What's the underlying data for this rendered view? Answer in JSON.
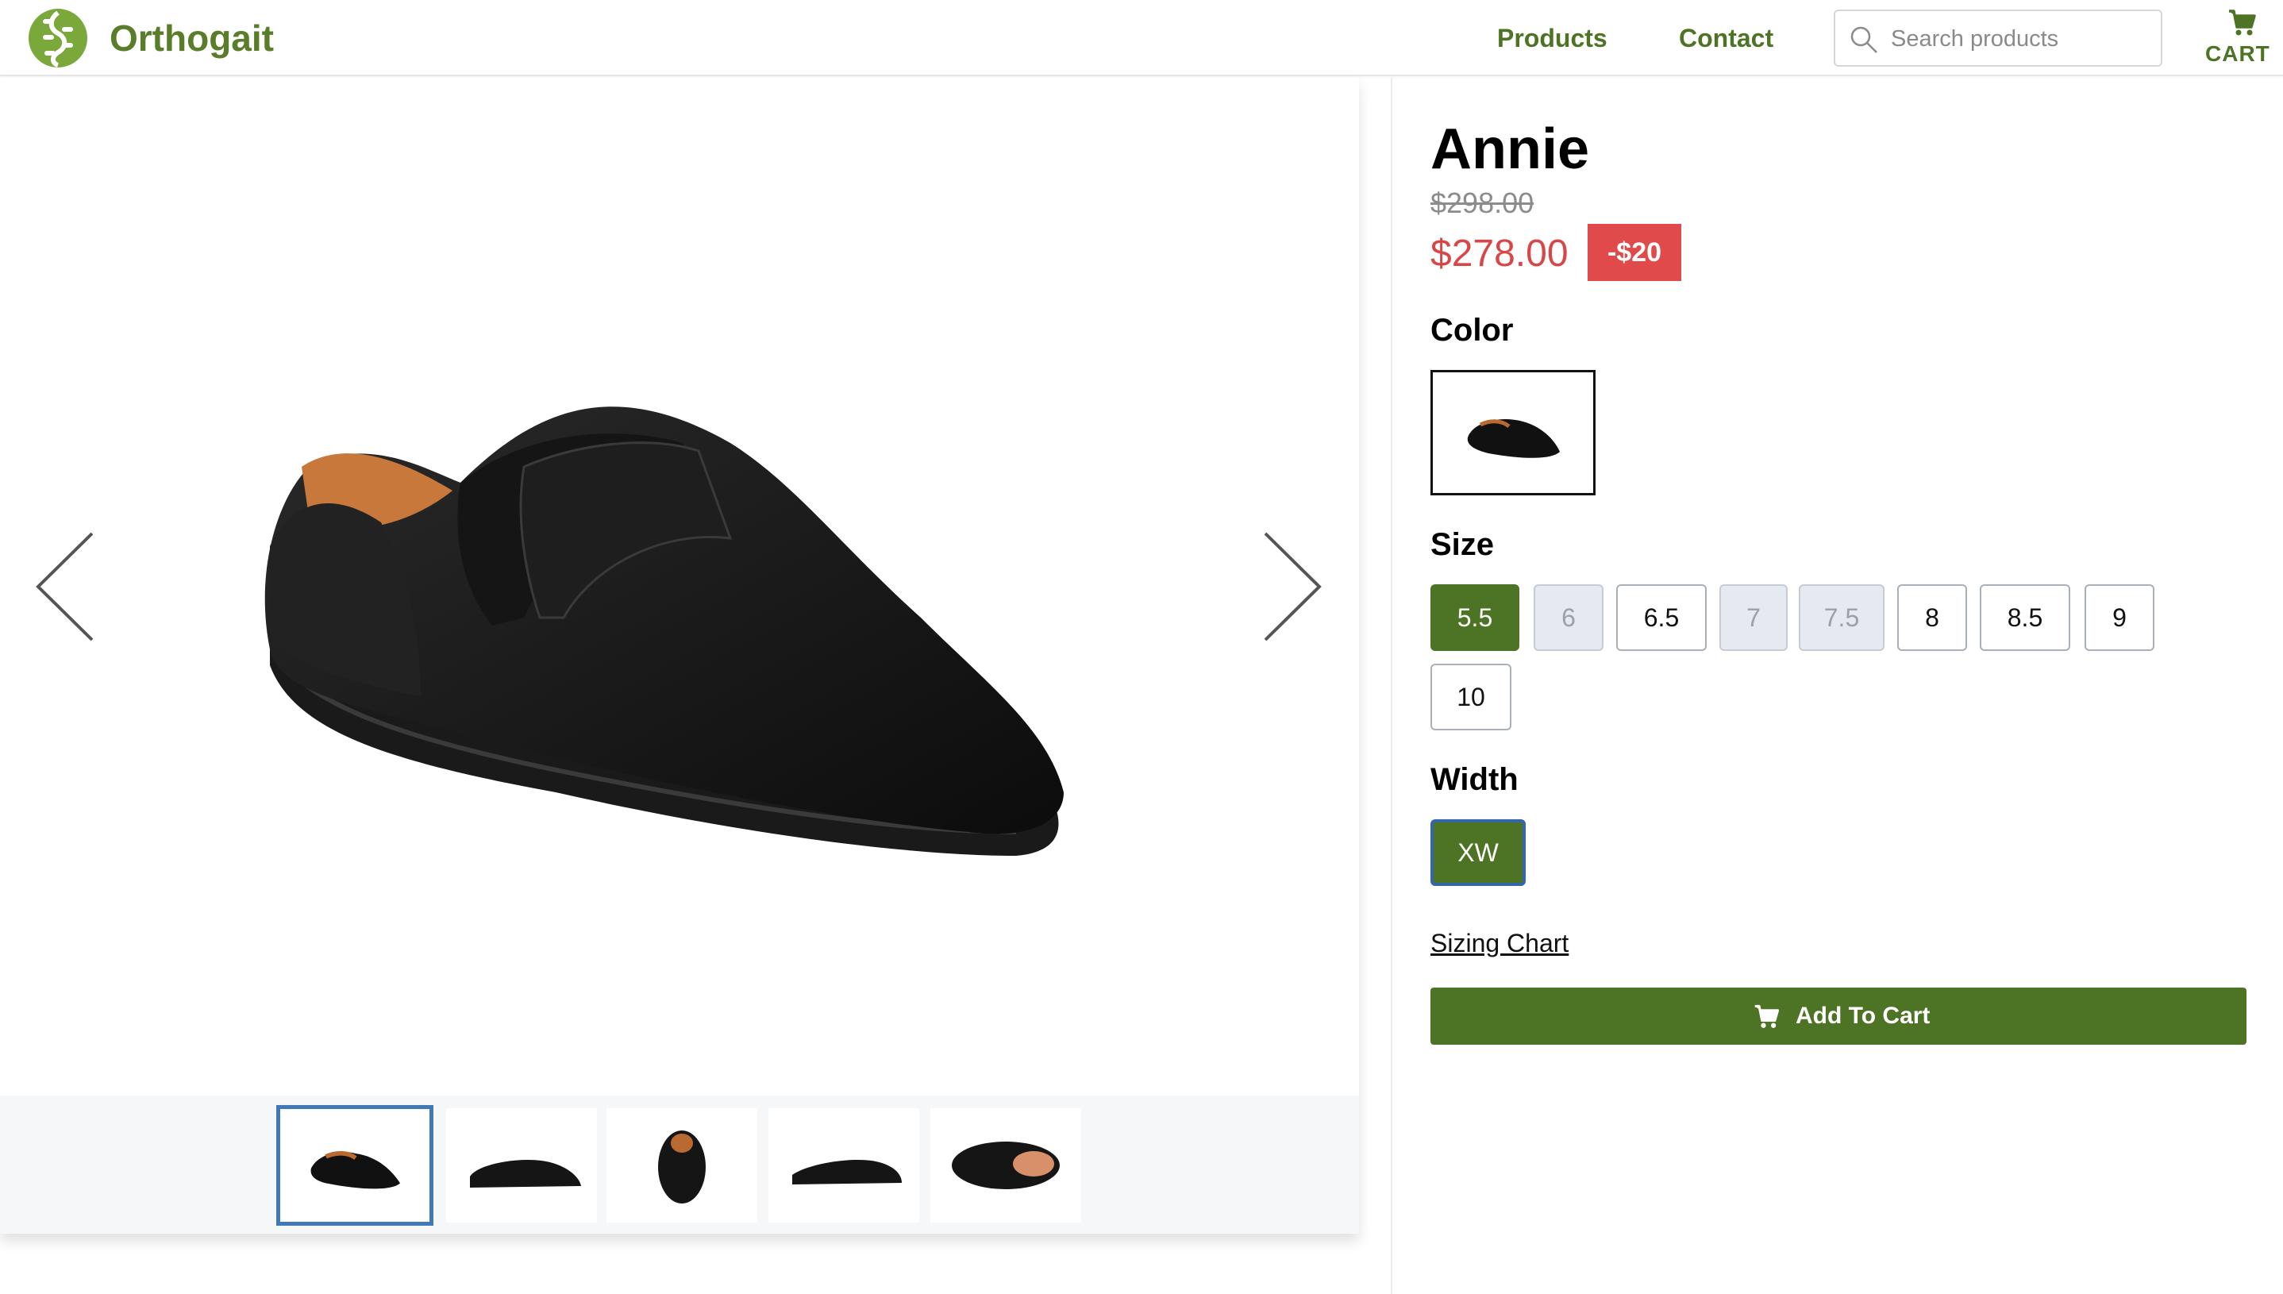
{
  "header": {
    "brand": "Orthogait",
    "nav": {
      "products": "Products",
      "contact": "Contact"
    },
    "search": {
      "placeholder": "Search products",
      "value": ""
    },
    "cart_label": "CART"
  },
  "gallery": {
    "thumbnails": [
      {
        "view": "three-quarter",
        "active": true
      },
      {
        "view": "side",
        "active": false
      },
      {
        "view": "top",
        "active": false
      },
      {
        "view": "side-flat",
        "active": false
      },
      {
        "view": "inner-top",
        "active": false
      }
    ]
  },
  "product": {
    "title": "Annie",
    "original_price": "$298.00",
    "sale_price": "$278.00",
    "discount_badge": "-$20",
    "color_label": "Color",
    "size_label": "Size",
    "width_label": "Width",
    "sizes": [
      {
        "label": "5.5",
        "state": "selected"
      },
      {
        "label": "6",
        "state": "disabled"
      },
      {
        "label": "6.5",
        "state": "available"
      },
      {
        "label": "7",
        "state": "disabled"
      },
      {
        "label": "7.5",
        "state": "disabled"
      },
      {
        "label": "8",
        "state": "available"
      },
      {
        "label": "8.5",
        "state": "available"
      },
      {
        "label": "9",
        "state": "available"
      },
      {
        "label": "10",
        "state": "available"
      }
    ],
    "width": {
      "label": "XW",
      "state": "selected"
    },
    "sizing_chart_link": "Sizing Chart",
    "add_to_cart": "Add To Cart"
  },
  "colors": {
    "brand_green": "#4c7424",
    "sale_red": "#d84747",
    "focus_blue": "#3f79b8"
  },
  "icons": {
    "logo": "spine-logo-icon",
    "search": "search-icon",
    "cart": "cart-icon",
    "prev": "chevron-left-icon",
    "next": "chevron-right-icon"
  }
}
